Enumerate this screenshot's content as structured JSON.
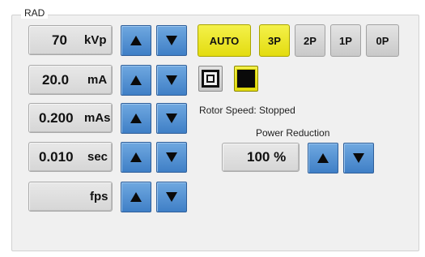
{
  "panel": {
    "title": "RAD"
  },
  "parameters": [
    {
      "id": "kvp",
      "value": "70",
      "unit": "kVp"
    },
    {
      "id": "ma",
      "value": "20.0",
      "unit": "mA"
    },
    {
      "id": "mas",
      "value": "0.200",
      "unit": "mAs"
    },
    {
      "id": "sec",
      "value": "0.010",
      "unit": "sec"
    },
    {
      "id": "fps",
      "value": "",
      "unit": "fps"
    }
  ],
  "modes": [
    {
      "label": "AUTO",
      "active": true
    },
    {
      "label": "3P",
      "active": true
    },
    {
      "label": "2P",
      "active": false
    },
    {
      "label": "1P",
      "active": false
    },
    {
      "label": "0P",
      "active": false
    }
  ],
  "focal_spot": {
    "small_icon": "small-focus-icon",
    "large_icon": "large-focus-icon",
    "active": "large"
  },
  "rotor_status": "Rotor Speed: Stopped",
  "power_reduction": {
    "label": "Power Reduction",
    "value": "100 %"
  },
  "colors": {
    "accent_blue": "#4a8ad4",
    "active_yellow": "#eae527",
    "inactive_grey": "#d4d4d4",
    "panel_bg": "#f0f0f0"
  }
}
